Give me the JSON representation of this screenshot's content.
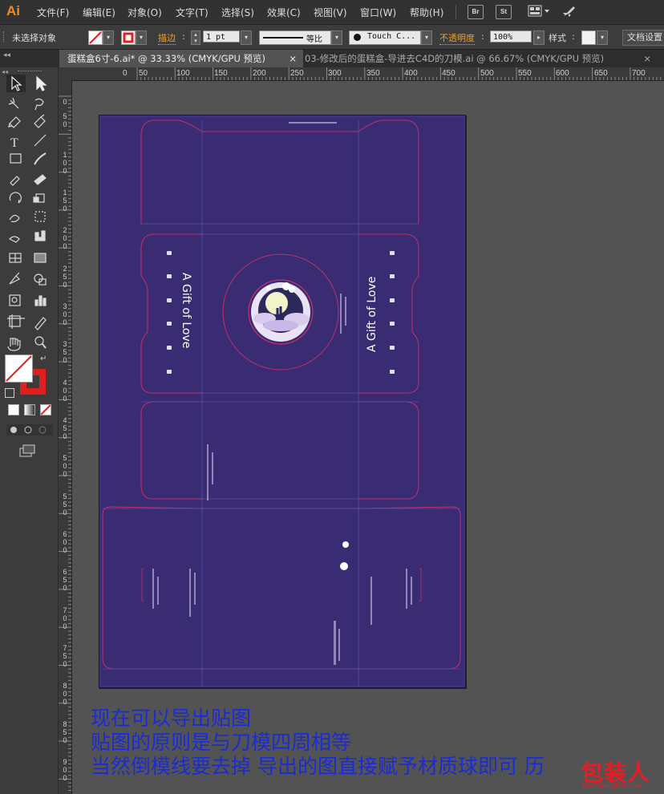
{
  "app": {
    "logo": "Ai"
  },
  "menu": {
    "items": [
      "文件(F)",
      "编辑(E)",
      "对象(O)",
      "文字(T)",
      "选择(S)",
      "效果(C)",
      "视图(V)",
      "窗口(W)",
      "帮助(H)"
    ]
  },
  "menu_buttons": {
    "bridge": "Br",
    "stock": "St"
  },
  "control_bar": {
    "selection_label": "未选择对象",
    "stroke_label": "描边",
    "stroke_weight": "1 pt",
    "profile_label": "等比",
    "brush_label": "Touch C...",
    "opacity_label": "不透明度",
    "opacity_value": "100%",
    "style_label": "样式",
    "doc_setup": "文档设置"
  },
  "tabs": [
    {
      "label": "蛋糕盒6寸-6.ai* @ 33.33% (CMYK/GPU 预览)",
      "close": "×",
      "active": true
    },
    {
      "label": "03-修改后的蛋糕盒-导进去C4D的刀模.ai @ 66.67% (CMYK/GPU 预览)",
      "close": "×",
      "active": false
    }
  ],
  "ruler": {
    "top": [
      "0",
      "50",
      "100",
      "150",
      "200",
      "250",
      "300",
      "350",
      "400",
      "450",
      "500",
      "550",
      "600",
      "650",
      "700"
    ],
    "left": [
      "0",
      "5 0",
      "1 0 0",
      "1 5 0",
      "2 0 0",
      "2 5 0",
      "3 0 0",
      "3 5 0",
      "4 0 0",
      "4 5 0",
      "5 0 0",
      "5 5 0",
      "6 0 0",
      "6 5 0",
      "7 0 0",
      "7 5 0",
      "8 0 0",
      "8 5 0",
      "9 0 0"
    ]
  },
  "artwork": {
    "title_left": "A Gift of Love",
    "title_right": "A Gift of Love",
    "colors": {
      "background": "#3a2c73",
      "dieline": "#c0306a",
      "fold": "#5a4ea8",
      "text": "#ffffff"
    }
  },
  "annotations": [
    "现在可以导出贴图",
    "贴图的原则是与刀模四周相等",
    "当然倒模线要去掉    导出的图直接赋予材质球即可   历"
  ],
  "watermark": {
    "text": "包装人",
    "sub": "BaoZhuangRen.com"
  }
}
